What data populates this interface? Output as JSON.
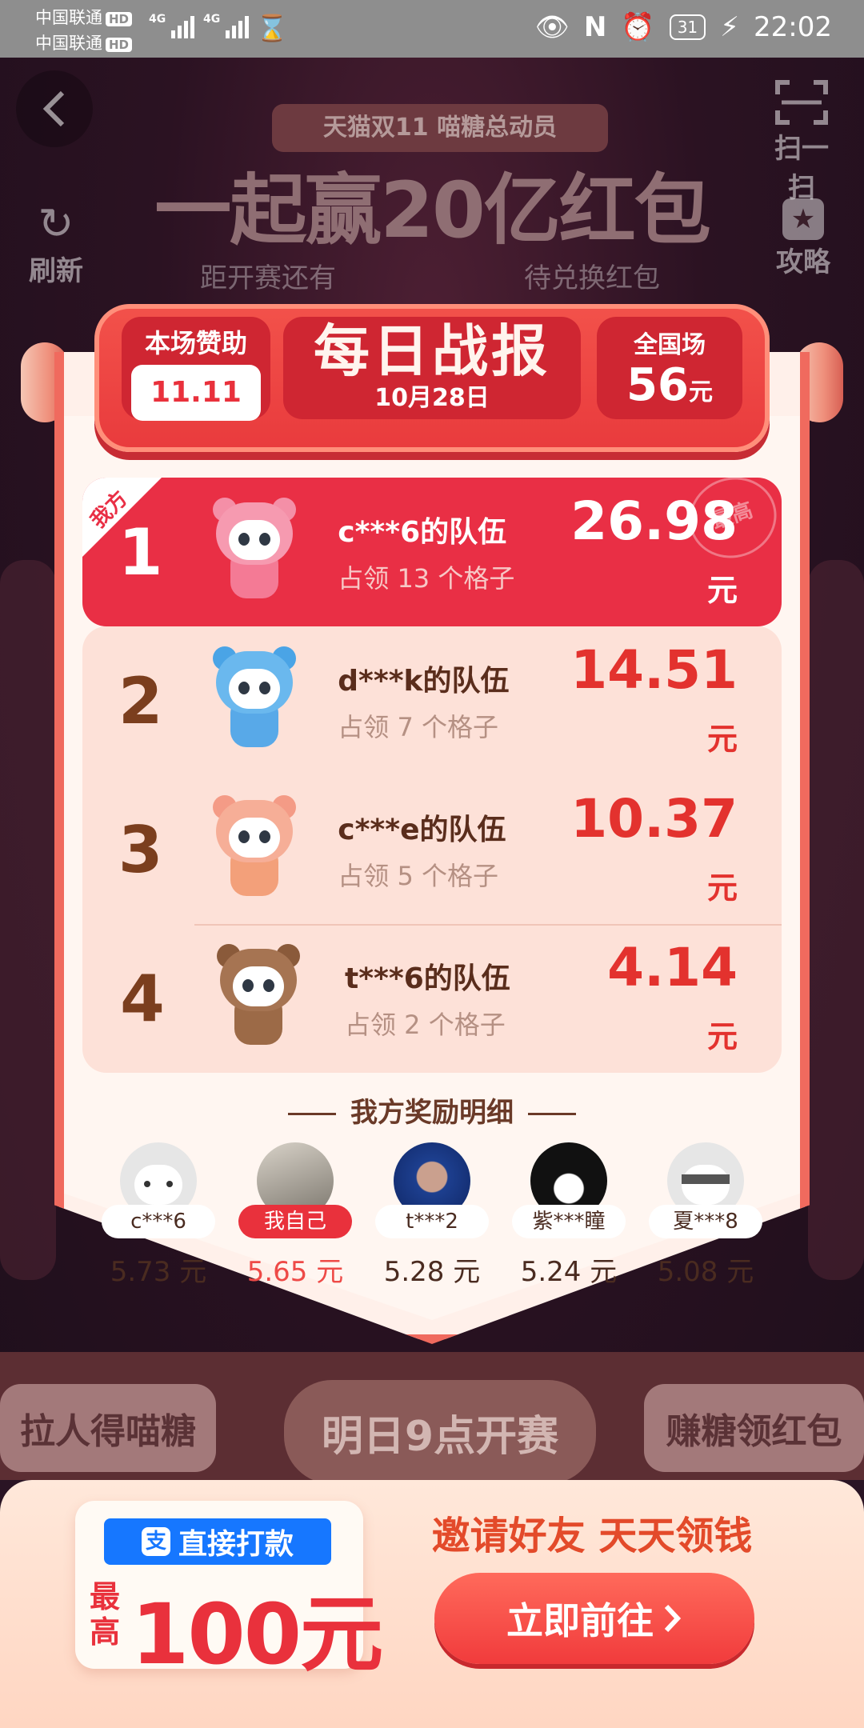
{
  "status_bar": {
    "carrier1": "中国联通",
    "carrier2": "中国联通",
    "hd": "HD",
    "network": "4G",
    "battery": "31",
    "time": "22:02"
  },
  "background": {
    "back_label": "<",
    "scan_label": "扫一扫",
    "refresh_label": "刷新",
    "guide_label": "攻略",
    "banner_subtitle": "天猫双11 喵糖总动员",
    "banner_title": "一起赢20亿红包",
    "countdown_label": "距开赛还有",
    "pending_label": "待兑换红包",
    "invite_button": "拉人得喵糖",
    "start_button": "明日9点开赛",
    "earn_button": "赚糖领红包"
  },
  "header": {
    "sponsor_label": "本场赞助",
    "sponsor_logo": "11.11",
    "title": "每日战报",
    "date": "10月28日",
    "national_label": "全国场",
    "national_amount": "56",
    "national_unit": "元"
  },
  "ranking": {
    "mine_badge": "我方",
    "top_seal": "最高",
    "unit": "元",
    "rows": [
      {
        "rank": "1",
        "team": "c***6的队伍",
        "sub": "占领 13 个格子",
        "amount": "26.98"
      },
      {
        "rank": "2",
        "team": "d***k的队伍",
        "sub": "占领 7 个格子",
        "amount": "14.51"
      },
      {
        "rank": "3",
        "team": "c***e的队伍",
        "sub": "占领 5 个格子",
        "amount": "10.37"
      },
      {
        "rank": "4",
        "team": "t***6的队伍",
        "sub": "占领 2 个格子",
        "amount": "4.14"
      }
    ]
  },
  "rewards": {
    "title": "我方奖励明细",
    "items": [
      {
        "name": "c***6",
        "amount": "5.73 元"
      },
      {
        "name": "我自己",
        "amount": "5.65 元"
      },
      {
        "name": "t***2",
        "amount": "5.28 元"
      },
      {
        "name": "紫***瞳",
        "amount": "5.24 元"
      },
      {
        "name": "夏***8",
        "amount": "5.08 元"
      }
    ]
  },
  "promo": {
    "tag": "直接打款",
    "alipay_icon_text": "支",
    "max_label": "最高",
    "amount": "100元",
    "title": "邀请好友 天天领钱",
    "button": "立即前往"
  },
  "colors": {
    "primary_red": "#e92f45",
    "amount_red": "#e3322e",
    "alipay_blue": "#1677ff",
    "row_bg": "#fde1d8"
  }
}
